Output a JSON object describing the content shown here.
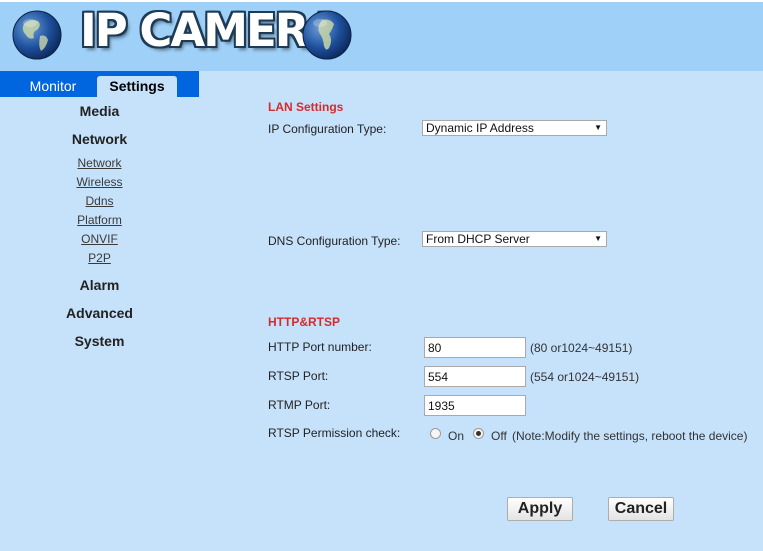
{
  "header": {
    "title": "IP CAMERA"
  },
  "tabs": {
    "monitor": "Monitor",
    "settings": "Settings"
  },
  "sidebar": {
    "media": "Media",
    "network": "Network",
    "network_items": [
      "Network",
      "Wireless",
      "Ddns",
      "Platform",
      "ONVIF",
      "P2P"
    ],
    "alarm": "Alarm",
    "advanced": "Advanced",
    "system": "System"
  },
  "lan": {
    "title": "LAN Settings",
    "ip_config_label": "IP Configuration Type:",
    "ip_config_value": "Dynamic IP Address",
    "dns_config_label": "DNS Configuration Type:",
    "dns_config_value": "From DHCP Server"
  },
  "http": {
    "title": "HTTP&RTSP",
    "http_port_label": "HTTP Port number:",
    "http_port_value": "80",
    "http_port_hint": "(80 or1024~49151)",
    "rtsp_port_label": "RTSP Port:",
    "rtsp_port_value": "554",
    "rtsp_port_hint": "(554 or1024~49151)",
    "rtmp_port_label": "RTMP Port:",
    "rtmp_port_value": "1935",
    "rtsp_perm_label": "RTSP Permission check:",
    "rtsp_perm_on": "On",
    "rtsp_perm_off": "Off",
    "rtsp_perm_selected": "Off",
    "rtsp_perm_note": "(Note:Modify the settings, reboot the device)"
  },
  "buttons": {
    "apply": "Apply",
    "cancel": "Cancel"
  },
  "colors": {
    "header_bg": "#9fd0f7",
    "page_bg": "#c6e2fb",
    "tab_bar": "#0066e0",
    "section_title": "#d42b2b"
  }
}
